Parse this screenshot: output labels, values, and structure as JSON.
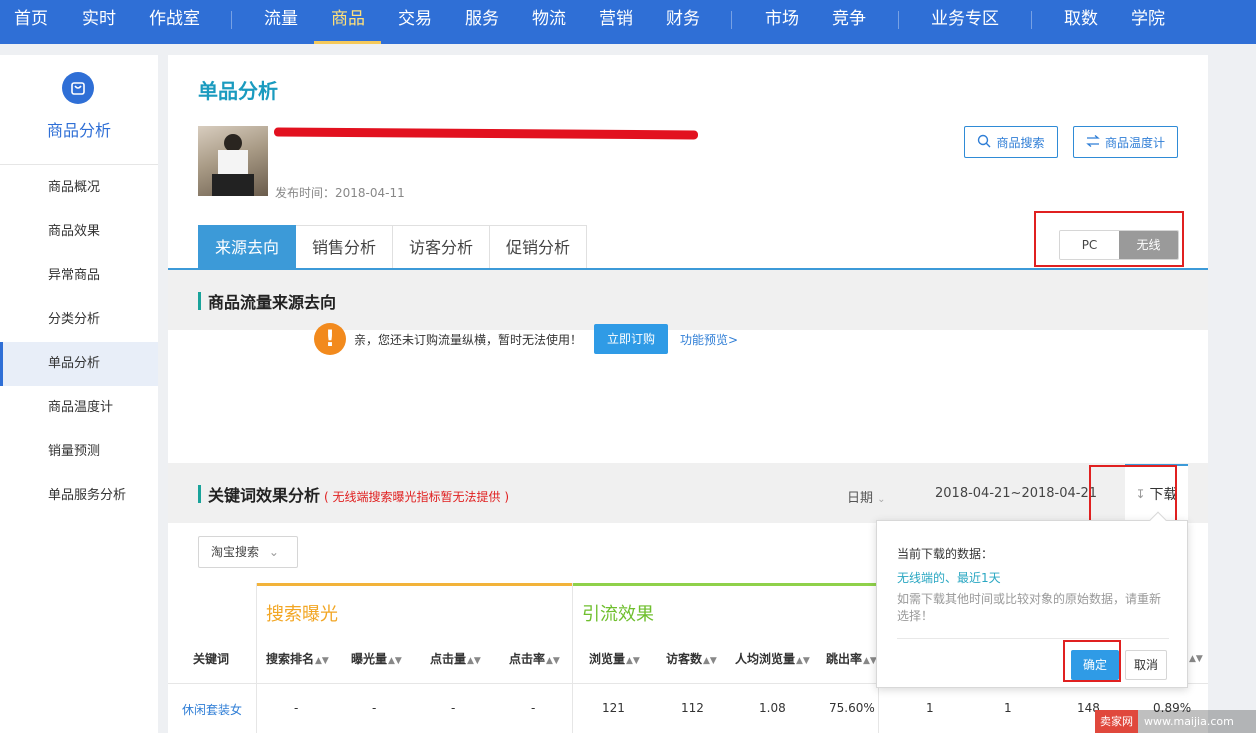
{
  "topnav": {
    "items": [
      "首页",
      "实时",
      "作战室",
      "流量",
      "商品",
      "交易",
      "服务",
      "物流",
      "营销",
      "财务",
      "市场",
      "竞争",
      "业务专区",
      "取数",
      "学院"
    ],
    "active": "商品"
  },
  "sidebar": {
    "title": "商品分析",
    "icon": "bag-icon",
    "items": [
      "商品概况",
      "商品效果",
      "异常商品",
      "分类分析",
      "单品分析",
      "商品温度计",
      "销量预测",
      "单品服务分析"
    ],
    "active": "单品分析"
  },
  "main": {
    "page_title": "单品分析",
    "product": {
      "publish_time": "发布时间：2018-04-11"
    },
    "buttons": {
      "search": "商品搜索",
      "thermo": "商品温度计"
    },
    "device_toggle": {
      "pc": "PC",
      "wireless": "无线",
      "selected": "无线"
    },
    "tabs": [
      "来源去向",
      "销售分析",
      "访客分析",
      "促销分析"
    ],
    "active_tab": "来源去向",
    "traffic_section": {
      "title": "商品流量来源去向",
      "warning_text": "亲，您还未订购流量纵横，暂时无法使用！",
      "subscribe_label": "立即订购",
      "preview_link": "功能预览>"
    },
    "keyword_section": {
      "title": "关键词效果分析",
      "note": "( 无线端搜索曝光指标暂无法提供 )",
      "date_label": "日期",
      "date_range": "2018-04-21~2018-04-21",
      "download_label": "下载",
      "source_select": "淘宝搜索",
      "group_search": "搜索曝光",
      "group_flow": "引流效果",
      "columns": [
        "关键词",
        "搜索排名",
        "曝光量",
        "点击量",
        "点击率",
        "浏览量",
        "访客数",
        "人均浏览量",
        "跳出率"
      ],
      "row": [
        "休闲套装女",
        "-",
        "-",
        "-",
        "-",
        "121",
        "112",
        "1.08",
        "75.60%",
        "1",
        "1",
        "148",
        "0.89%"
      ]
    }
  },
  "popup": {
    "title": "当前下载的数据：",
    "highlight": "无线端的、最近1天",
    "desc": "如需下载其他时间或比较对象的原始数据，请重新选择！",
    "ok": "确定",
    "cancel": "取消"
  },
  "watermark": {
    "logo": "卖家网",
    "url": "www.maijia.com"
  },
  "colors": {
    "nav": "#2f6fd6",
    "accent": "#3c9ad8",
    "warn": "#f28a1d",
    "highlight_red": "#e02020"
  }
}
